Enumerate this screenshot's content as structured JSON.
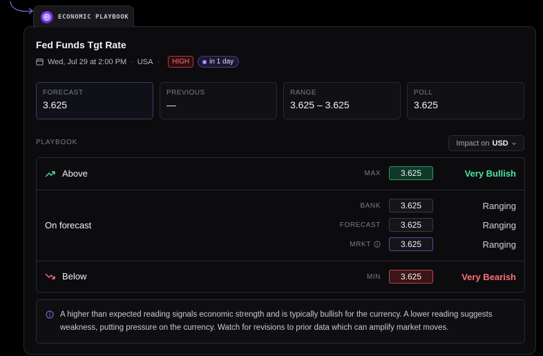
{
  "tab": {
    "label": "ECONOMIC PLAYBOOK",
    "icon": "globe-icon"
  },
  "event": {
    "title": "Fed Funds Tgt Rate",
    "datetime": "Wed, Jul 29 at 2:00 PM",
    "country": "USA",
    "impact_badge": "HIGH",
    "countdown": "in 1 day"
  },
  "stats": [
    {
      "label": "FORECAST",
      "value": "3.625"
    },
    {
      "label": "PREVIOUS",
      "value": "—"
    },
    {
      "label": "RANGE",
      "value": "3.625 – 3.625"
    },
    {
      "label": "POLL",
      "value": "3.625"
    }
  ],
  "playbook": {
    "header": "PLAYBOOK",
    "impact_prefix": "Impact on",
    "impact_currency": "USD",
    "above": {
      "label": "Above",
      "key": "MAX",
      "value": "3.625",
      "outcome": "Very Bullish"
    },
    "on_forecast": {
      "label": "On forecast",
      "lines": [
        {
          "key": "BANK",
          "value": "3.625",
          "outcome": "Ranging"
        },
        {
          "key": "FORECAST",
          "value": "3.625",
          "outcome": "Ranging"
        },
        {
          "key": "MRKT",
          "value": "3.625",
          "outcome": "Ranging"
        }
      ]
    },
    "below": {
      "label": "Below",
      "key": "MIN",
      "value": "3.625",
      "outcome": "Very Bearish"
    }
  },
  "note": "A higher than expected reading signals economic strength and is typically bullish for the currency. A lower reading suggests weakness, putting pressure on the currency. Watch for revisions to prior data which can amplify market moves.",
  "colors": {
    "accent": "#7b3ff0",
    "bullish": "#4ee3a0",
    "bearish": "#ff6f7a",
    "high": "#ff7077"
  }
}
